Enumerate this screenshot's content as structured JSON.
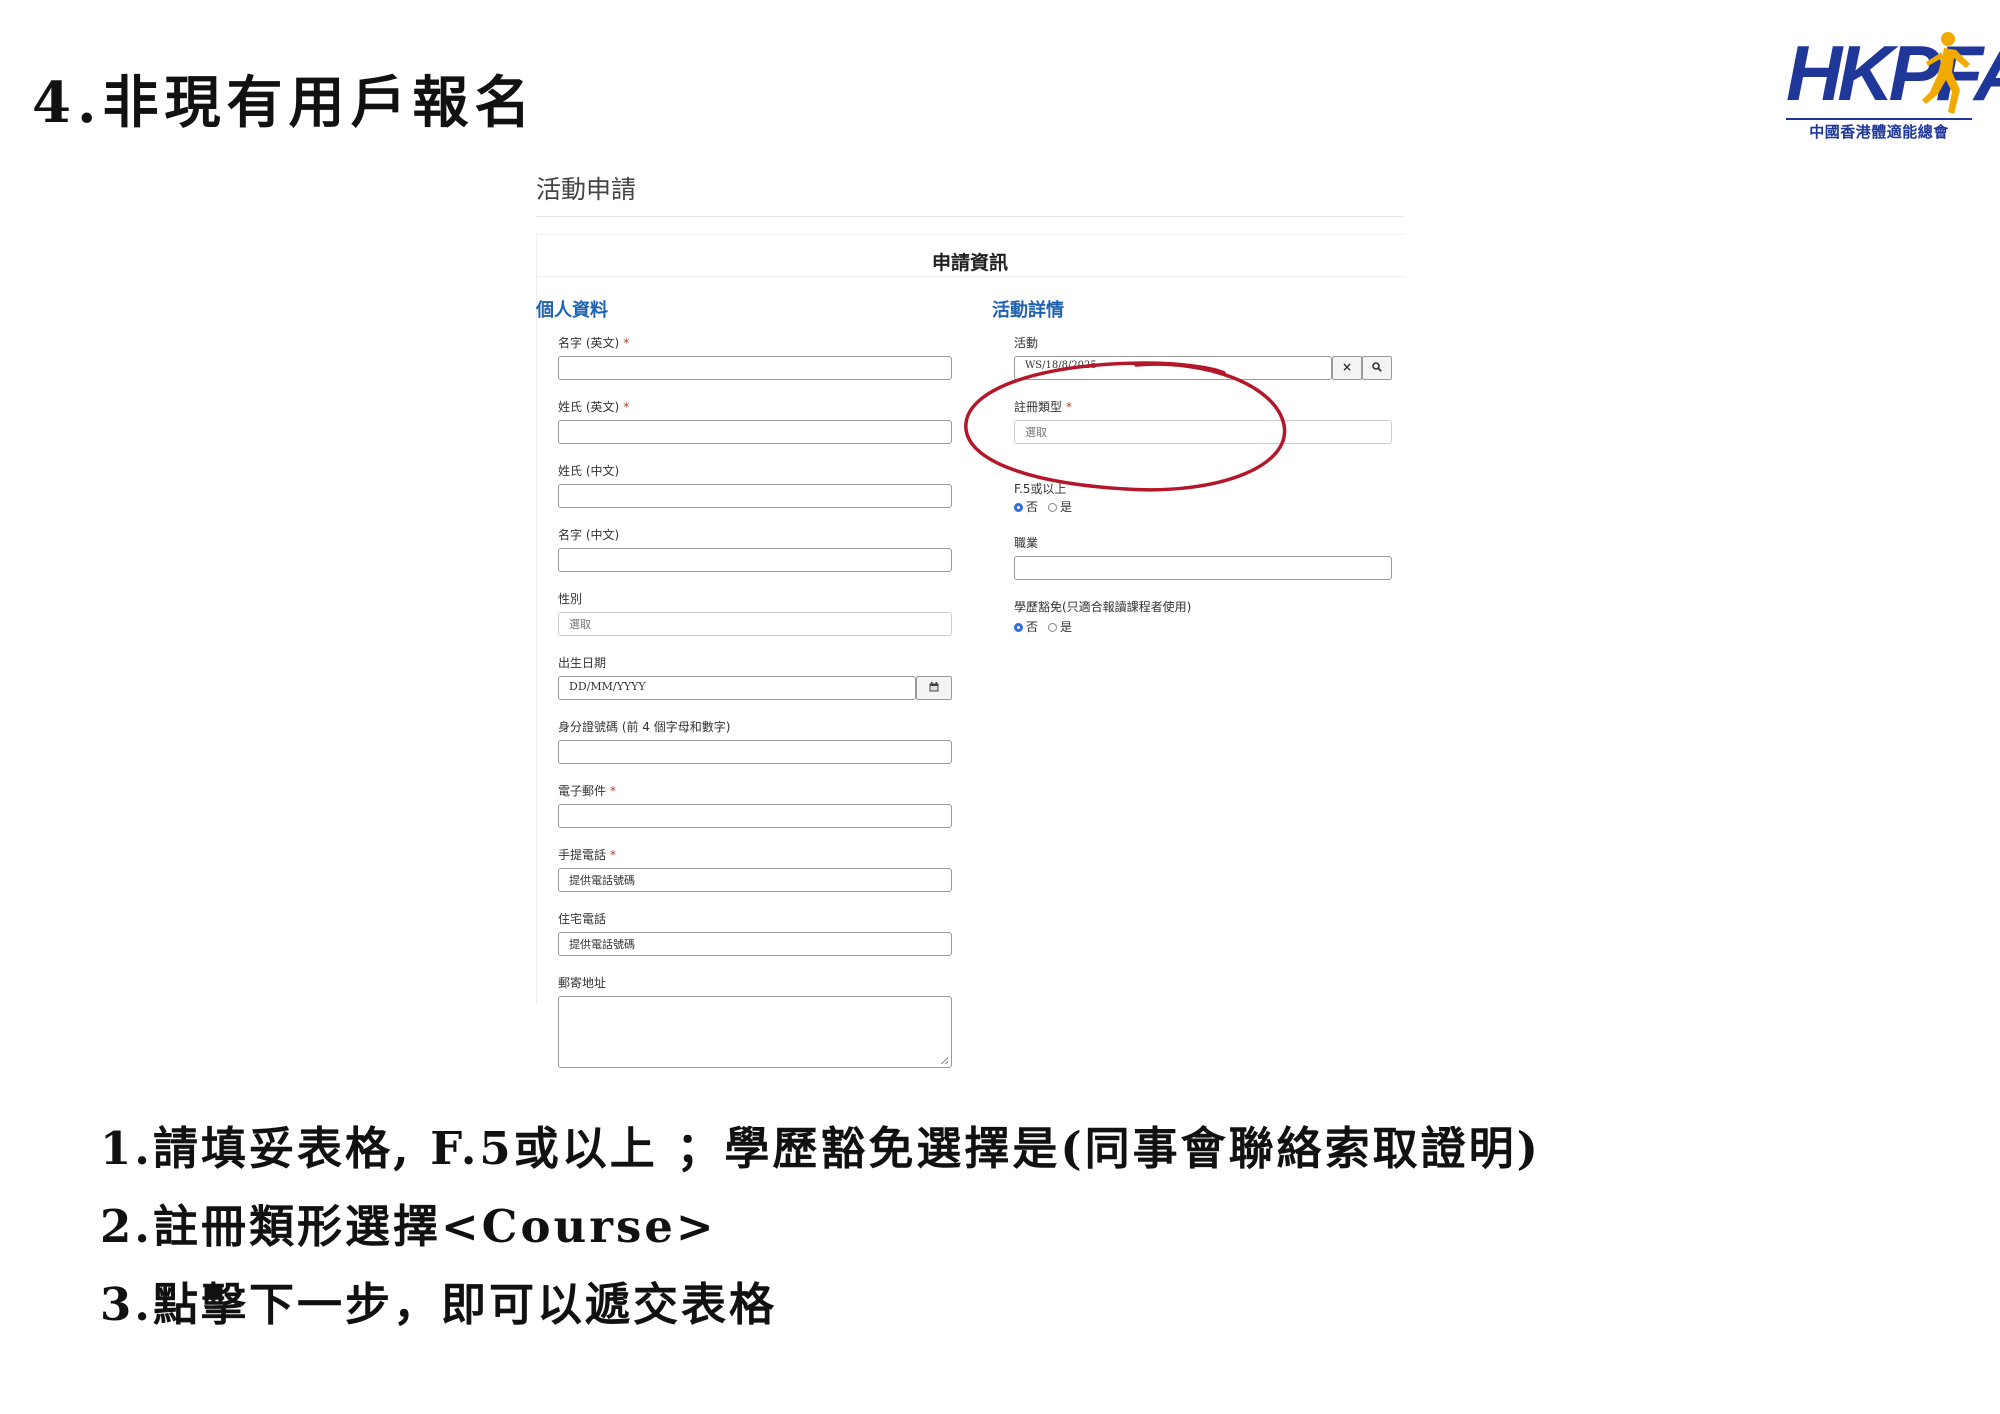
{
  "slide": {
    "title": "4.非現有用戶報名"
  },
  "logo": {
    "text": "HKPFA",
    "subtitle": "中國香港體適能總會",
    "colors": {
      "primary": "#20379a",
      "accent": "#f2a900"
    }
  },
  "form": {
    "heading": "活動申請",
    "section_title": "申請資訊",
    "left_column": {
      "title": "個人資料",
      "fields": [
        {
          "label": "名字 (英文)",
          "required": true,
          "value": ""
        },
        {
          "label": "姓氏 (英文)",
          "required": true,
          "value": ""
        },
        {
          "label": "姓氏 (中文)",
          "required": false,
          "value": ""
        },
        {
          "label": "名字 (中文)",
          "required": false,
          "value": ""
        },
        {
          "label": "性別",
          "required": false,
          "value": "選取"
        },
        {
          "label": "出生日期",
          "required": false,
          "placeholder": "DD/MM/YYYY"
        },
        {
          "label": "身分證號碼 (前 4 個字母和數字)",
          "required": false,
          "value": ""
        },
        {
          "label": "電子郵件",
          "required": true,
          "value": ""
        },
        {
          "label": "手提電話",
          "required": true,
          "placeholder": "提供電話號碼"
        },
        {
          "label": "住宅電話",
          "required": false,
          "placeholder": "提供電話號碼"
        },
        {
          "label": "郵寄地址",
          "required": false,
          "value": ""
        }
      ]
    },
    "right_column": {
      "title": "活動詳情",
      "activity": {
        "label": "活動",
        "value": "WS/18/8/2025",
        "clear_icon": "×",
        "search_icon": "search-icon"
      },
      "registration_type": {
        "label": "註冊類型",
        "required": true,
        "value": "選取"
      },
      "f5_or_above": {
        "label": "F.5或以上",
        "options": [
          "否",
          "是"
        ],
        "selected": "否"
      },
      "occupation": {
        "label": "職業",
        "value": ""
      },
      "education_exemption": {
        "label": "學歷豁免(只適合報讀課程者使用)",
        "options": [
          "否",
          "是"
        ],
        "selected": "否"
      }
    },
    "required_marker": "*",
    "calendar_icon": "calendar-icon",
    "highlight_color": "#b5172a"
  },
  "instructions": [
    "1.請填妥表格, F.5或以上 ；學歷豁免選擇是(同事會聯絡索取證明)",
    "2.註冊類形選擇<Course>",
    "3.點擊下一步，即可以遞交表格"
  ]
}
